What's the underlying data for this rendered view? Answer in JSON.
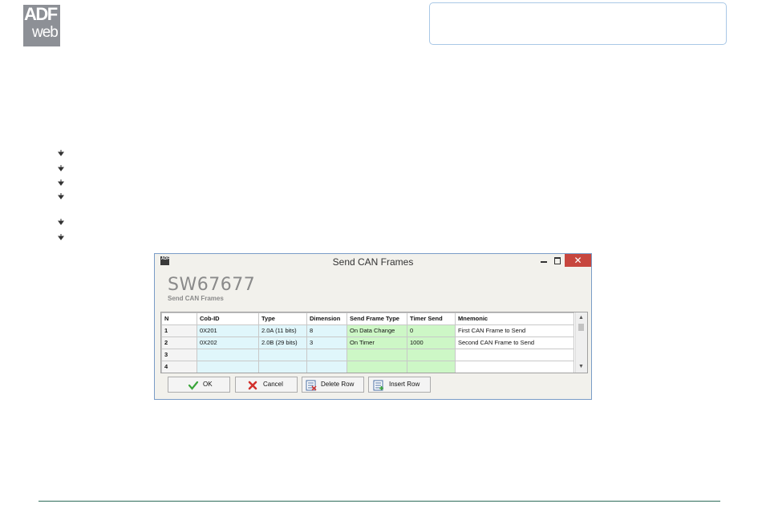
{
  "brand": {
    "logo_line1": "ADF",
    "logo_line2": "web"
  },
  "window": {
    "title": "Send CAN Frames",
    "app_icon_text": "ADF",
    "close_glyph": "✕",
    "app_title": "SW67677",
    "app_subtitle": "Send CAN Frames"
  },
  "table": {
    "columns": [
      "N",
      "Cob-ID",
      "Type",
      "Dimension",
      "Send Frame Type",
      "Timer Send",
      "Mnemonic"
    ],
    "rows": [
      {
        "n": "1",
        "cob_id": "0X201",
        "type": "2.0A (11 bits)",
        "dimension": "8",
        "send_frame_type": "On Data Change",
        "timer_send": "0",
        "mnemonic": "First CAN Frame to Send"
      },
      {
        "n": "2",
        "cob_id": "0X202",
        "type": "2.0B (29 bits)",
        "dimension": "3",
        "send_frame_type": "On Timer",
        "timer_send": "1000",
        "mnemonic": "Second CAN Frame to Send"
      },
      {
        "n": "3",
        "cob_id": "",
        "type": "",
        "dimension": "",
        "send_frame_type": "",
        "timer_send": "",
        "mnemonic": ""
      },
      {
        "n": "4",
        "cob_id": "",
        "type": "",
        "dimension": "",
        "send_frame_type": "",
        "timer_send": "",
        "mnemonic": ""
      }
    ]
  },
  "buttons": {
    "ok": "OK",
    "cancel": "Cancel",
    "delete_row": "Delete Row",
    "insert_row": "Insert Row"
  },
  "icons": {
    "ok": "checkmark-icon",
    "cancel": "cross-icon",
    "delete_row": "delete-row-icon",
    "insert_row": "insert-row-icon",
    "bullet": "arrow-bullet-icon"
  },
  "colors": {
    "cyan_cells": "#e0f6fb",
    "green_cells": "#cdf7c6",
    "close_button": "#c7463e",
    "footer_line": "#2e6b5a"
  }
}
